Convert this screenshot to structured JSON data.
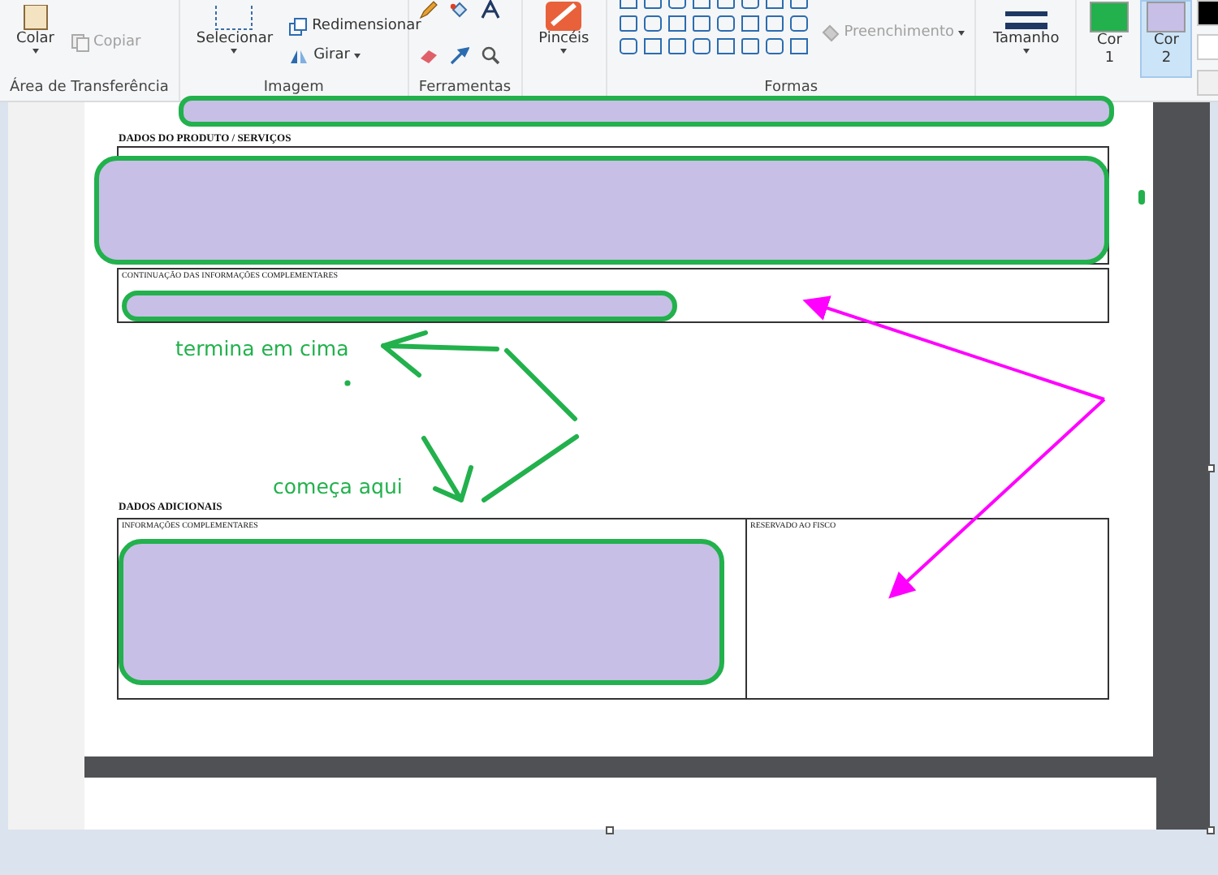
{
  "ribbon": {
    "clipboard": {
      "paste": "Colar",
      "copy": "Copiar",
      "copy_disabled": true,
      "label": "Área de Transferência"
    },
    "image": {
      "select": "Selecionar",
      "resize": "Redimensionar",
      "rotate": "Girar",
      "label": "Imagem"
    },
    "tools": {
      "label": "Ferramentas"
    },
    "brushes": {
      "label": "Pincéis"
    },
    "shapes": {
      "fill": "Preenchimento",
      "fill_disabled": true,
      "label": "Formas"
    },
    "size": {
      "label": "Tamanho"
    },
    "colors": [
      {
        "label": "Cor 1",
        "color": "#22b14c",
        "selected": false
      },
      {
        "label": "Cor 2",
        "color": "#c8bfe7",
        "selected": true
      }
    ]
  },
  "document": {
    "product_heading": "DADOS DO PRODUTO / SERVIÇOS",
    "continuation_label": "CONTINUAÇÃO DAS INFORMAÇÕES COMPLEMENTARES",
    "additional_heading": "DADOS ADICIONAIS",
    "info_label": "INFORMAÇÕES COMPLEMENTARES",
    "fisco_label": "RESERVADO AO FISCO"
  },
  "annotations": {
    "end_note": "termina em cima",
    "start_note": "começa aqui"
  }
}
